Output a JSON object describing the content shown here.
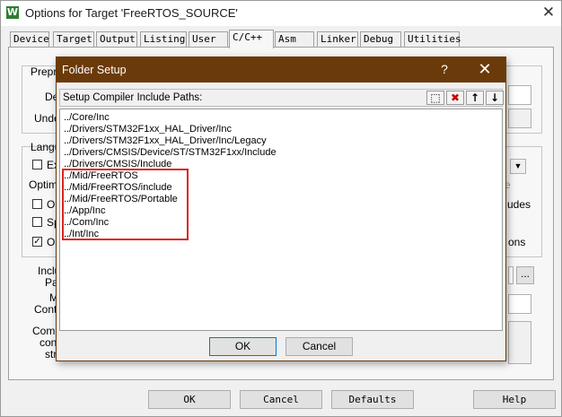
{
  "window": {
    "title": "Options for Target 'FreeRTOS_SOURCE'",
    "app_icon_glyph": "W",
    "close_glyph": "✕"
  },
  "tabs": [
    {
      "label": "Device"
    },
    {
      "label": "Target"
    },
    {
      "label": "Output"
    },
    {
      "label": "Listing"
    },
    {
      "label": "User"
    },
    {
      "label": "C/C++",
      "active": true
    },
    {
      "label": "Asm"
    },
    {
      "label": "Linker"
    },
    {
      "label": "Debug"
    },
    {
      "label": "Utilities"
    }
  ],
  "background_panel": {
    "prepro_label": "Prepro",
    "de_label": "De",
    "unde_label": "Unde",
    "langu_label": "Langu",
    "ex_label": "Ex",
    "optimiz_label": "Optimiz",
    "op_label": "Op",
    "sp_label": "Sp",
    "on_label": "On",
    "include_label": "Includ",
    "pat_label": "Pat",
    "m_label": "M",
    "contr_label": "Contr",
    "comp_label": "Comp",
    "con_label": "con",
    "str_label": "str",
    "e_label": "e",
    "udes_label": "udes",
    "ons_label": "ons",
    "check_on": "✓",
    "browse_label": "..."
  },
  "dialog": {
    "title": "Folder Setup",
    "help_glyph": "?",
    "close_glyph": "✕",
    "header_label": "Setup Compiler Include Paths:",
    "toolbar": [
      {
        "name": "new-folder-icon",
        "glyph": "⬚"
      },
      {
        "name": "delete-icon",
        "glyph": "✖",
        "color": "#cc0000"
      },
      {
        "name": "move-up-icon",
        "glyph": "↑"
      },
      {
        "name": "move-down-icon",
        "glyph": "↓"
      }
    ],
    "paths": [
      "../Core/Inc",
      "../Drivers/STM32F1xx_HAL_Driver/Inc",
      "../Drivers/STM32F1xx_HAL_Driver/Inc/Legacy",
      "../Drivers/CMSIS/Device/ST/STM32F1xx/Include",
      "../Drivers/CMSIS/Include",
      "../Mid/FreeRTOS",
      "../Mid/FreeRTOS/include",
      "../Mid/FreeRTOS/Portable",
      "../App/Inc",
      "../Com/Inc",
      "../Int/Inc"
    ],
    "highlight_color": "#e02020",
    "ok_label": "OK",
    "cancel_label": "Cancel"
  },
  "footer": {
    "ok_label": "OK",
    "cancel_label": "Cancel",
    "defaults_label": "Defaults",
    "help_label": "Help"
  }
}
